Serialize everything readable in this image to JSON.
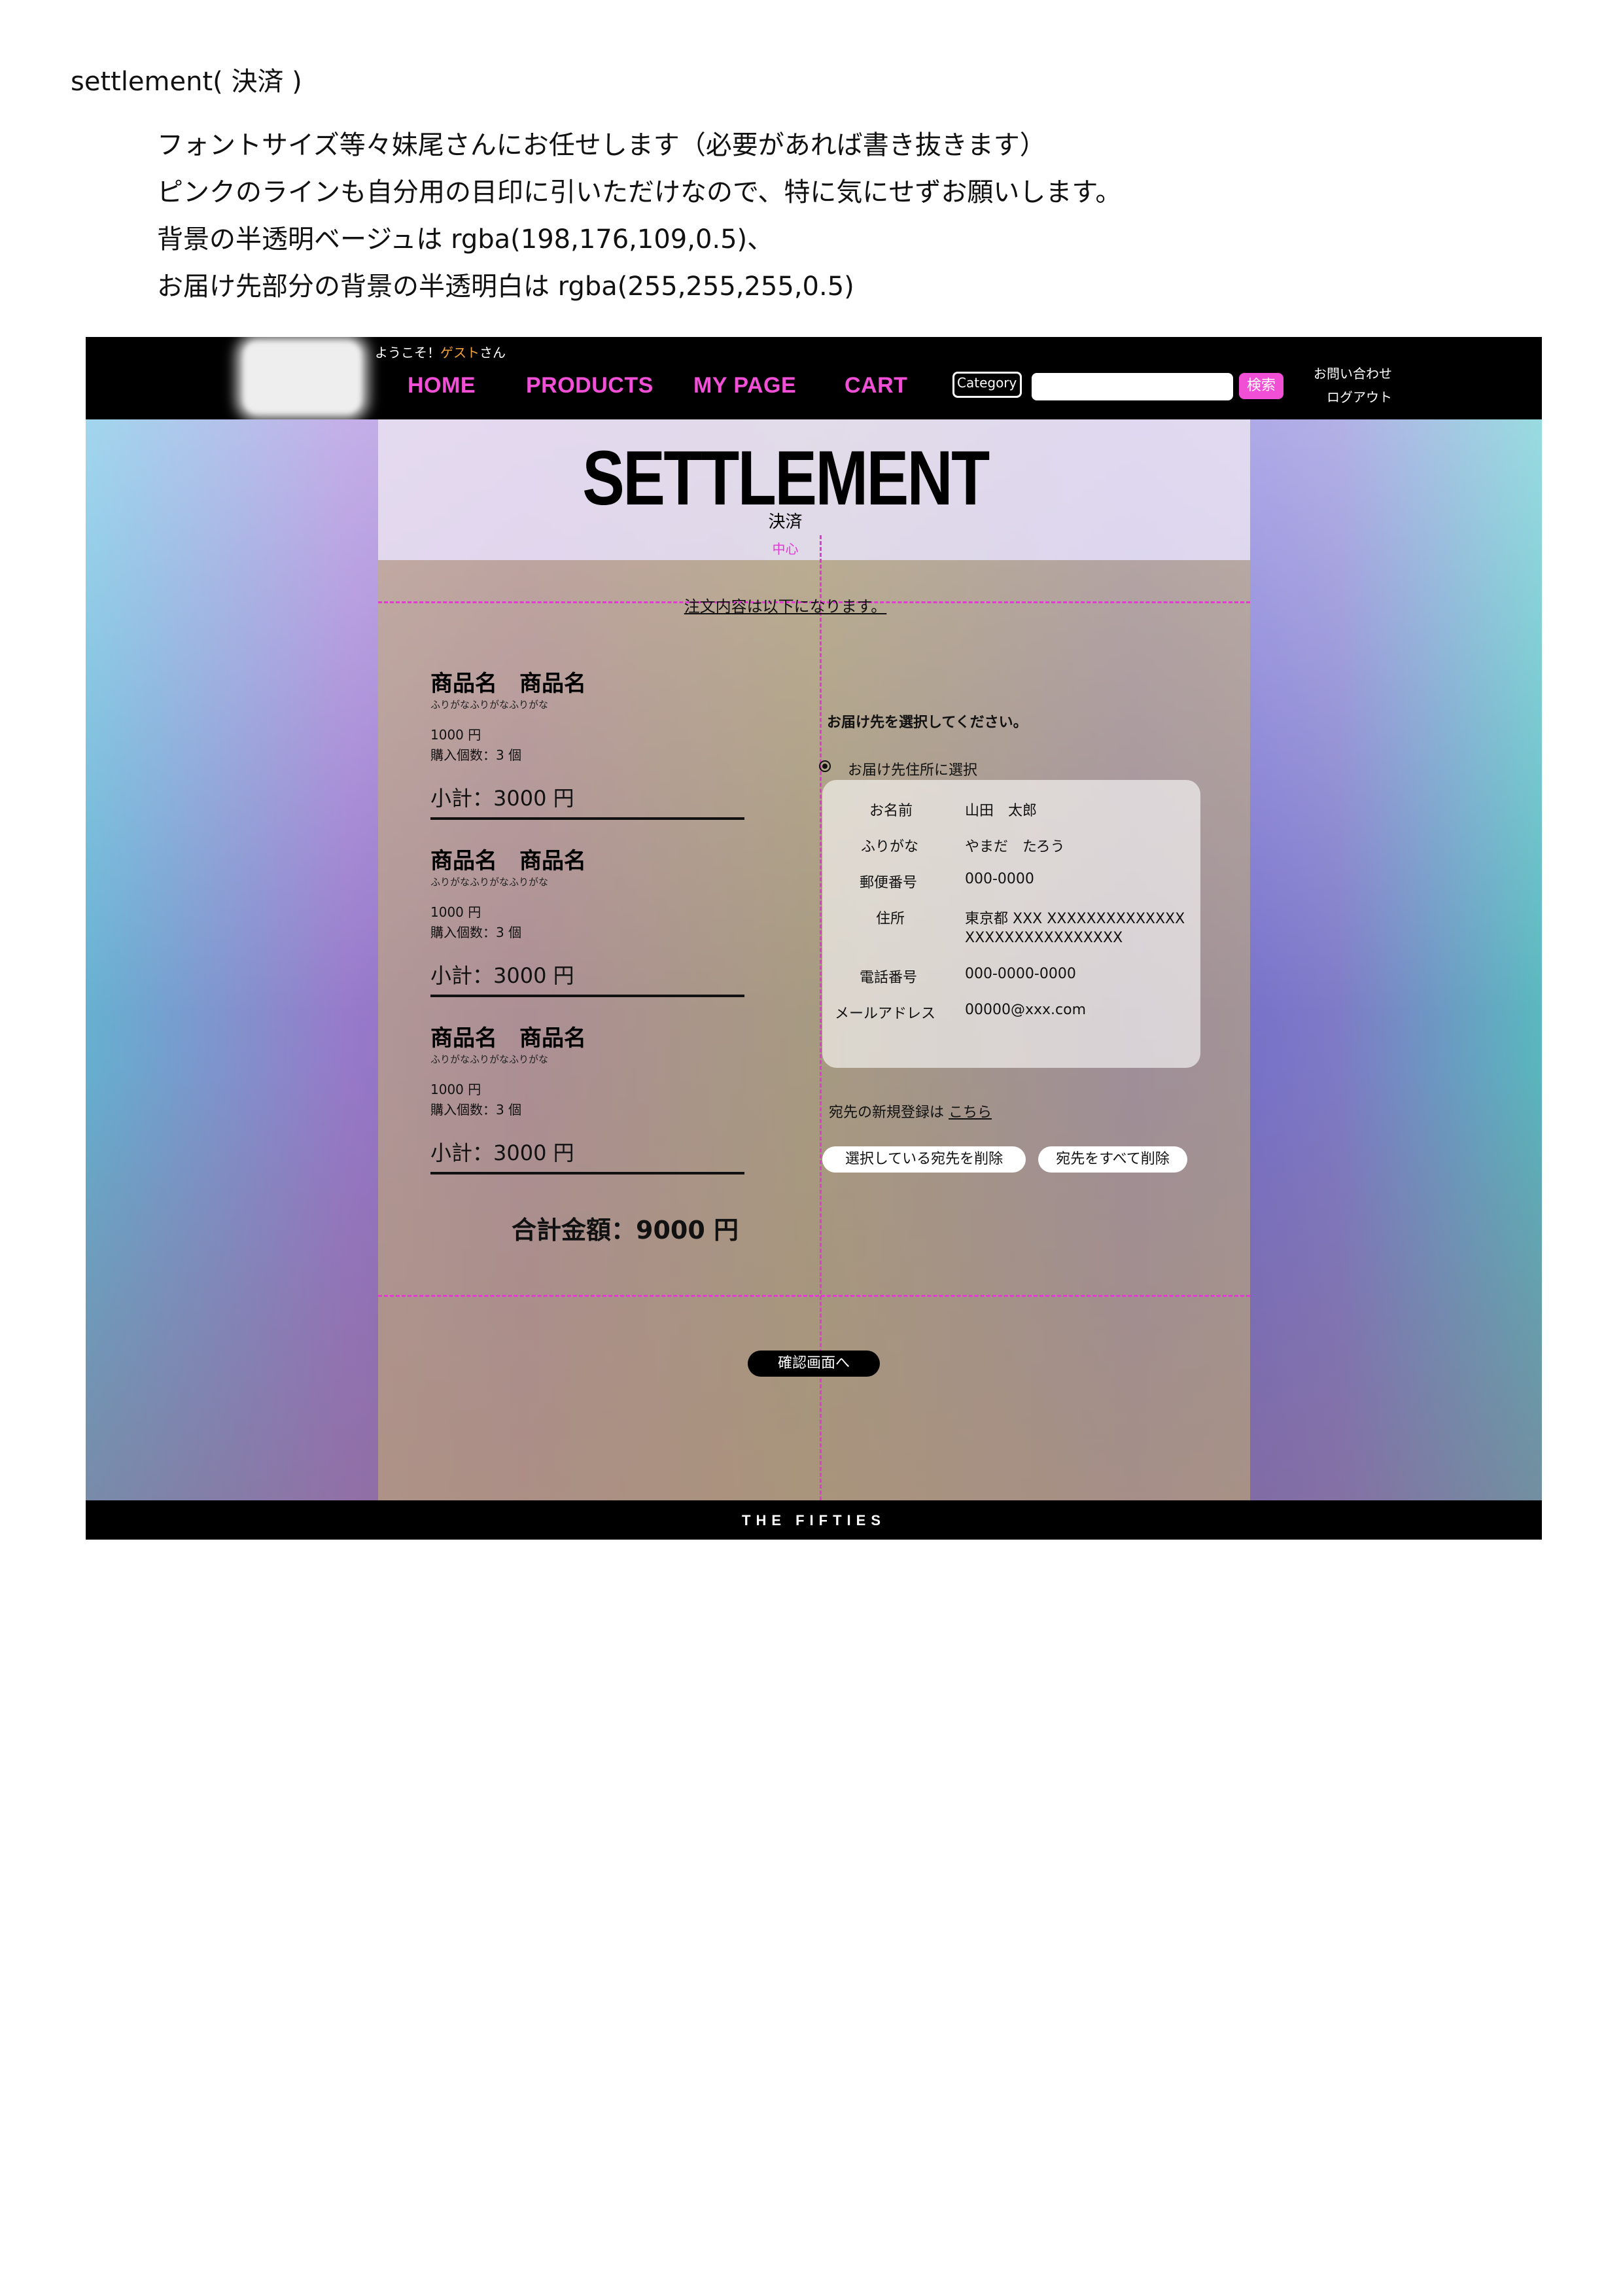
{
  "doc": {
    "title": "settlement( 決済 )",
    "notes": [
      "フォントサイズ等々妹尾さんにお任せします（必要があれば書き抜きます）",
      "ピンクのラインも自分用の目印に引いただけなので、特に気にせずお願いします。",
      "背景の半透明ベージュは rgba(198,176,109,0.5)、",
      "お届け先部分の背景の半透明白は rgba(255,255,255,0.5)"
    ]
  },
  "header": {
    "welcome_prefix": "ようこそ！",
    "welcome_guest": "ゲスト",
    "welcome_suffix": "さん",
    "nav": [
      "HOME",
      "PRODUCTS",
      "MY PAGE",
      "CART"
    ],
    "category_label": "Category",
    "search_input_value": "",
    "search_button": "検索",
    "contact": "お問い合わせ",
    "logout": "ログアウト"
  },
  "page": {
    "title": "SETTLEMENT",
    "subtitle": "決済",
    "center_label": "中心",
    "order_notice": "注文内容は以下になります。"
  },
  "items": [
    {
      "name": "商品名　商品名",
      "kana": "ふりがなふりがなふりがな",
      "price": "1000 円",
      "quantity": "購入個数：3 個",
      "subtotal": "小計：3000 円"
    },
    {
      "name": "商品名　商品名",
      "kana": "ふりがなふりがなふりがな",
      "price": "1000 円",
      "quantity": "購入個数：3 個",
      "subtotal": "小計：3000 円"
    },
    {
      "name": "商品名　商品名",
      "kana": "ふりがなふりがなふりがな",
      "price": "1000 円",
      "quantity": "購入個数：3 個",
      "subtotal": "小計：3000 円"
    }
  ],
  "total": "合計金額：9000 円",
  "delivery": {
    "prompt": "お届け先を選択してください。",
    "radio_label": "お届け先住所に選択",
    "fields": [
      {
        "label": "お名前",
        "value": "山田　太郎"
      },
      {
        "label": "ふりがな",
        "value": "やまだ　たろう"
      },
      {
        "label": "郵便番号",
        "value": "000-0000"
      },
      {
        "label": "住所",
        "value": "東京都 XXX XXXXXXXXXXXXXX",
        "value2": "XXXXXXXXXXXXXXXX"
      },
      {
        "label": "電話番号",
        "value": "000-0000-0000"
      },
      {
        "label": "メールアドレス",
        "value": "00000@xxx.com"
      }
    ],
    "new_addr_text": "宛先の新規登録は",
    "new_addr_link": "こちら",
    "delete_selected": "選択している宛先を削除",
    "delete_all": "宛先をすべて削除"
  },
  "confirm_button": "確認画面へ",
  "footer": "THE FIFTIES"
}
